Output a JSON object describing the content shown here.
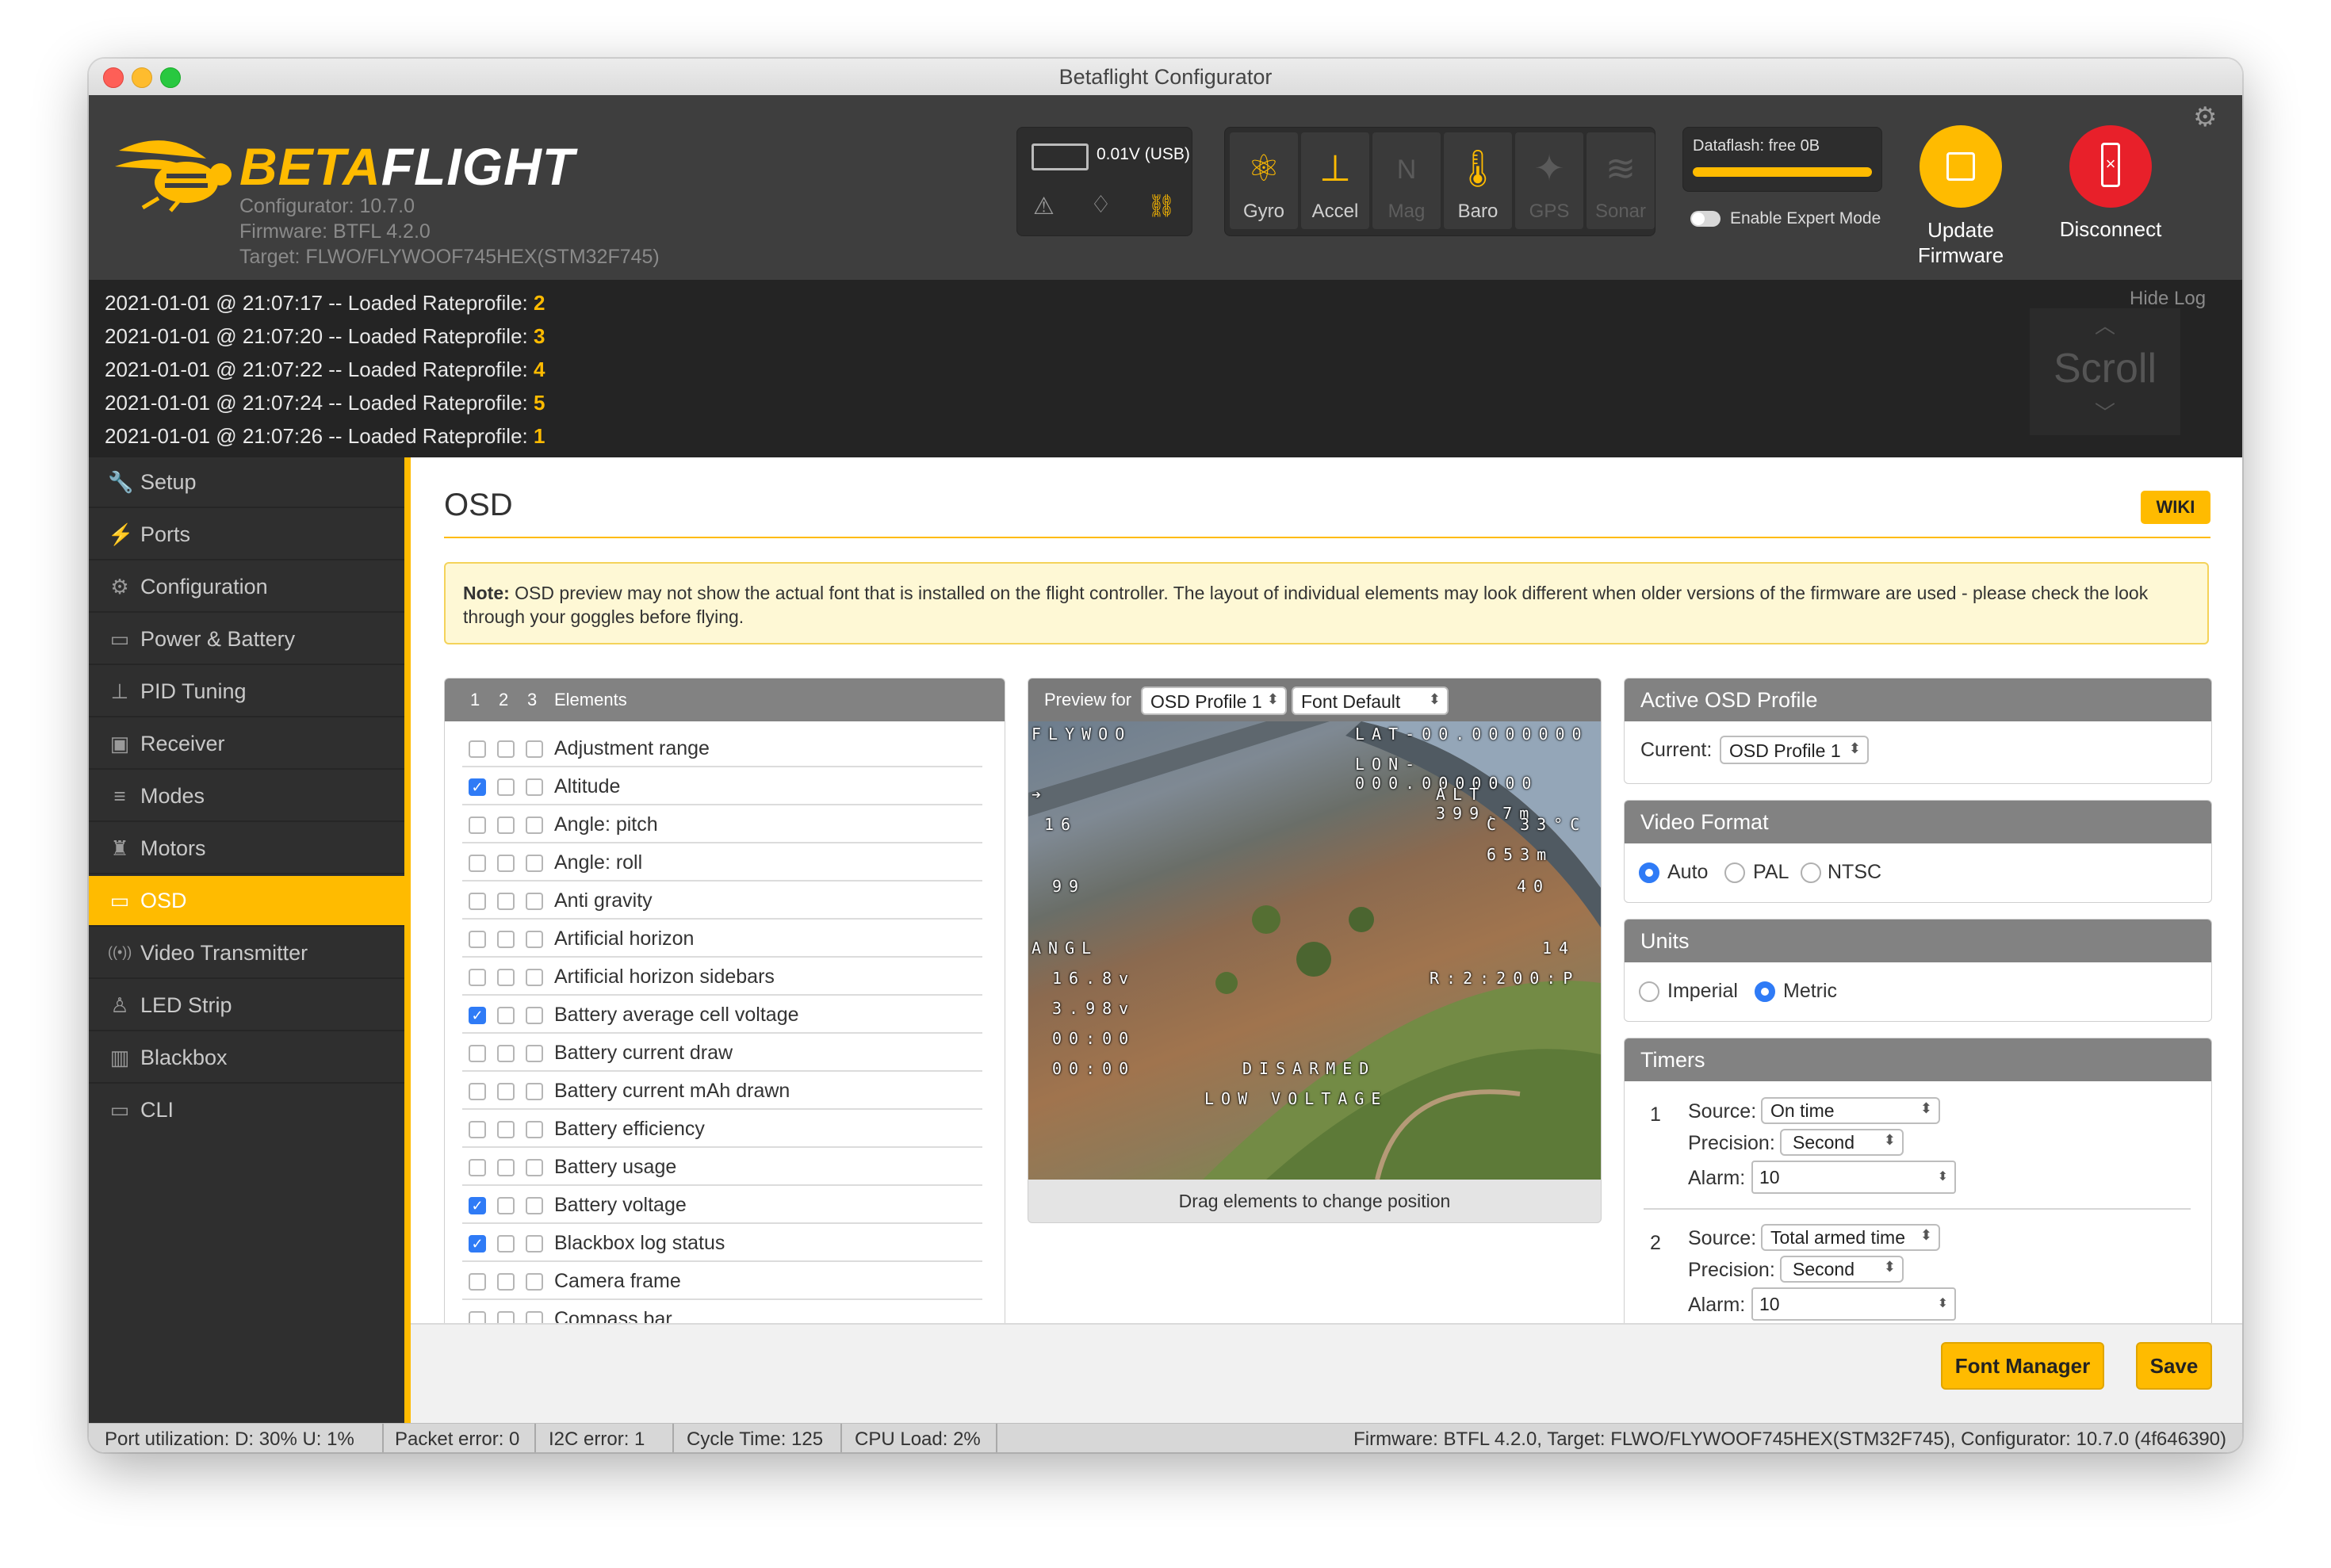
{
  "window": {
    "title": "Betaflight Configurator"
  },
  "header": {
    "brand_beta": "BETA",
    "brand_flight": "FLIGHT",
    "configurator": "Configurator: 10.7.0",
    "firmware": "Firmware: BTFL 4.2.0",
    "target": "Target: FLWO/FLYWOOF745HEX(STM32F745)",
    "battery_voltage": "0.01V (USB)",
    "sensors": [
      {
        "label": "Gyro",
        "icon": "gyro-icon",
        "active": true
      },
      {
        "label": "Accel",
        "icon": "accel-icon",
        "active": true
      },
      {
        "label": "Mag",
        "icon": "mag-icon",
        "active": false
      },
      {
        "label": "Baro",
        "icon": "baro-icon",
        "active": true
      },
      {
        "label": "GPS",
        "icon": "gps-icon",
        "active": false
      },
      {
        "label": "Sonar",
        "icon": "sonar-icon",
        "active": false
      }
    ],
    "dataflash": "Dataflash: free 0B",
    "expert_mode": "Enable Expert Mode",
    "update_firmware": "Update Firmware",
    "disconnect": "Disconnect"
  },
  "log": {
    "lines": [
      {
        "text": "2021-01-01 @ 21:07:17 -- Loaded Rateprofile: ",
        "value": "2"
      },
      {
        "text": "2021-01-01 @ 21:07:20 -- Loaded Rateprofile: ",
        "value": "3"
      },
      {
        "text": "2021-01-01 @ 21:07:22 -- Loaded Rateprofile: ",
        "value": "4"
      },
      {
        "text": "2021-01-01 @ 21:07:24 -- Loaded Rateprofile: ",
        "value": "5"
      },
      {
        "text": "2021-01-01 @ 21:07:26 -- Loaded Rateprofile: ",
        "value": "1"
      }
    ],
    "hide_log": "Hide Log",
    "scroll": "Scroll"
  },
  "sidebar": {
    "items": [
      {
        "label": "Setup",
        "icon": "wrench-icon",
        "glyph": "🔧"
      },
      {
        "label": "Ports",
        "icon": "plug-icon",
        "glyph": "⚡"
      },
      {
        "label": "Configuration",
        "icon": "gear-icon",
        "glyph": "⚙"
      },
      {
        "label": "Power & Battery",
        "icon": "battery-icon",
        "glyph": "▭"
      },
      {
        "label": "PID Tuning",
        "icon": "sitemap-icon",
        "glyph": "⊥"
      },
      {
        "label": "Receiver",
        "icon": "receiver-icon",
        "glyph": "▣"
      },
      {
        "label": "Modes",
        "icon": "modes-icon",
        "glyph": "≡"
      },
      {
        "label": "Motors",
        "icon": "motor-icon",
        "glyph": "♜"
      },
      {
        "label": "OSD",
        "icon": "osd-icon",
        "glyph": "▭",
        "active": true
      },
      {
        "label": "Video Transmitter",
        "icon": "antenna-icon",
        "glyph": "((•))"
      },
      {
        "label": "LED Strip",
        "icon": "led-icon",
        "glyph": "♙"
      },
      {
        "label": "Blackbox",
        "icon": "blackbox-icon",
        "glyph": "▥"
      },
      {
        "label": "CLI",
        "icon": "terminal-icon",
        "glyph": "▭"
      }
    ]
  },
  "main": {
    "title": "OSD",
    "wiki": "WIKI",
    "note_label": "Note:",
    "note_text": " OSD preview may not show the actual font that is installed on the flight controller. The layout of individual elements may look different when older versions of the firmware are used - please check the look through your goggles before flying.",
    "elements_header": {
      "cols": [
        "1",
        "2",
        "3"
      ],
      "label": "Elements"
    },
    "elements": [
      {
        "name": "Adjustment range",
        "checked": [
          false,
          false,
          false
        ]
      },
      {
        "name": "Altitude",
        "checked": [
          true,
          false,
          false
        ]
      },
      {
        "name": "Angle: pitch",
        "checked": [
          false,
          false,
          false
        ]
      },
      {
        "name": "Angle: roll",
        "checked": [
          false,
          false,
          false
        ]
      },
      {
        "name": "Anti gravity",
        "checked": [
          false,
          false,
          false
        ]
      },
      {
        "name": "Artificial horizon",
        "checked": [
          false,
          false,
          false
        ]
      },
      {
        "name": "Artificial horizon sidebars",
        "checked": [
          false,
          false,
          false
        ]
      },
      {
        "name": "Battery average cell voltage",
        "checked": [
          true,
          false,
          false
        ]
      },
      {
        "name": "Battery current draw",
        "checked": [
          false,
          false,
          false
        ]
      },
      {
        "name": "Battery current mAh drawn",
        "checked": [
          false,
          false,
          false
        ]
      },
      {
        "name": "Battery efficiency",
        "checked": [
          false,
          false,
          false
        ]
      },
      {
        "name": "Battery usage",
        "checked": [
          false,
          false,
          false
        ]
      },
      {
        "name": "Battery voltage",
        "checked": [
          true,
          false,
          false
        ]
      },
      {
        "name": "Blackbox log status",
        "checked": [
          true,
          false,
          false
        ]
      },
      {
        "name": "Camera frame",
        "checked": [
          false,
          false,
          false
        ]
      },
      {
        "name": "Compass bar",
        "checked": [
          false,
          false,
          false
        ]
      }
    ],
    "preview": {
      "label": "Preview for",
      "profile": "OSD Profile 1",
      "font": "Font Default",
      "caption": "Drag elements to change position",
      "osd": {
        "craft": "FLYWOO",
        "lat": "LAT-00.0000000",
        "lon": "LON-000.0000000",
        "alt": "ALT 399.7m",
        "temp": "C 33°C",
        "home": "653m",
        "speed": "40",
        "dir": "14",
        "sats": "16",
        "rssi": "99",
        "angl": "ANGL",
        "avg_cell": "16.8v",
        "cell": "3.98v",
        "timer1": "00:00",
        "timer2": "00:00",
        "rates": "R:2:200:P",
        "disarmed": "DISARMED",
        "low_voltage": "LOW VOLTAGE"
      }
    },
    "active_profile": {
      "title": "Active OSD Profile",
      "current_label": "Current:",
      "current": "OSD Profile 1"
    },
    "video_format": {
      "title": "Video Format",
      "options": [
        "Auto",
        "PAL",
        "NTSC"
      ],
      "selected": "Auto"
    },
    "units": {
      "title": "Units",
      "options": [
        "Imperial",
        "Metric"
      ],
      "selected": "Metric"
    },
    "timers": {
      "title": "Timers",
      "items": [
        {
          "index": "1",
          "source_label": "Source:",
          "source": "On time",
          "precision_label": "Precision:",
          "precision": "Second",
          "alarm_label": "Alarm:",
          "alarm": "10"
        },
        {
          "index": "2",
          "source_label": "Source:",
          "source": "Total armed time",
          "precision_label": "Precision:",
          "precision": "Second",
          "alarm_label": "Alarm:",
          "alarm": "10"
        }
      ]
    },
    "font_manager": "Font Manager",
    "save": "Save"
  },
  "status": {
    "port_util": "Port utilization: D: 30% U: 1%",
    "packet_error": "Packet error: 0",
    "i2c_error": "I2C error: 1",
    "cycle_time": "Cycle Time: 125",
    "cpu_load": "CPU Load: 2%",
    "firmware_info": "Firmware: BTFL 4.2.0, Target: FLWO/FLYWOOF745HEX(STM32F745), Configurator: 10.7.0 (4f646390)"
  },
  "colors": {
    "accent": "#ffbb00",
    "checkbox": "#2f7bf6",
    "header_bg": "#3e3e3e",
    "sidebar_bg": "#2f2f2f",
    "disconnect": "#e8202a"
  }
}
